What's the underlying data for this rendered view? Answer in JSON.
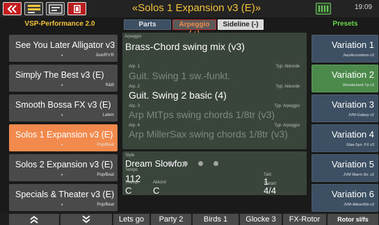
{
  "topbar": {
    "title": "«Solos 1 Expansion v3 (E)»",
    "clock": "19:09",
    "icons": [
      "back-icon",
      "registration-icon",
      "screen-icon",
      "record-icon",
      "clock-icon"
    ]
  },
  "header": {
    "left_title": "VSP-Performance 2.0",
    "tabs": [
      {
        "label": "Parts"
      },
      {
        "label": "Arpeggio (✓)"
      },
      {
        "label": "Sideline (-)"
      }
    ],
    "right_title": "Presets"
  },
  "styles": [
    {
      "name": "See You Later Alligator v3",
      "dot": "•",
      "category": "Jive/R'n'R"
    },
    {
      "name": "Simply The Best v3 (E)",
      "dot": "•",
      "category": "R&B"
    },
    {
      "name": "Smooth Bossa FX v3 (E)",
      "dot": "•",
      "category": "Latein"
    },
    {
      "name": "Solos 1 Expansion v3 (E)",
      "dot": "•",
      "category": "Pop/Beat"
    },
    {
      "name": "Solos 2 Expansion v3 (E)",
      "dot": "•",
      "category": "Pop/Beat"
    },
    {
      "name": "Specials & Theater v3 (E)",
      "dot": "•",
      "category": "Pop/Beat"
    }
  ],
  "arpeggio": {
    "label": "Arpeggio",
    "name": "Brass-Chord swing mix (v3)",
    "arps": [
      {
        "label": "Arp. 1",
        "typ": "Typ: Akkorde",
        "name": "Guit. Swing 1 sw.-funkt."
      },
      {
        "label": "Arp. 2",
        "typ": "Typ: Akkorde",
        "name": "Guit. Swing 2 basic (4)"
      },
      {
        "label": "Arp. 3",
        "typ": "Typ: Arpeggio",
        "name": "Arp MtTps swing chords 1/8tr (v3)"
      },
      {
        "label": "Arp. 4",
        "typ": "Typ: Arpeggio",
        "name": "Arp MillerSax swing chords 1/8tr (v3)"
      }
    ]
  },
  "style_panel": {
    "label": "Style",
    "name": "Dream Slowfox",
    "tempo_label": "Tempo",
    "tempo": "112",
    "takt_label": "Takt",
    "takt": "1",
    "transp_label": "Transp.",
    "transp": "C",
    "akkord_label": "Akkord",
    "akkord": "C",
    "taktart_label": "Taktart",
    "taktart": "4/4"
  },
  "variations": [
    {
      "name": "Variation 1",
      "sub": "JazzAccordeon v3"
    },
    {
      "name": "Variation 2",
      "sub": "Wonderland-Tp v3"
    },
    {
      "name": "Variation 3",
      "sub": "JVM-Galaxy v2"
    },
    {
      "name": "Variation 4",
      "sub": "Glas-Syn. FX v3"
    },
    {
      "name": "Variation 5",
      "sub": "JVM Warm-Str. v2"
    },
    {
      "name": "Variation 6",
      "sub": "JVM-AkkordStr.v3"
    }
  ],
  "bottombar": {
    "up_icon": "double-chevron-up-icon",
    "down_icon": "double-chevron-down-icon",
    "buttons": [
      "Lets go",
      "Party 2",
      "Birds 1",
      "Glocke 3",
      "FX-Rotor",
      "Rotor sl/fs"
    ]
  }
}
